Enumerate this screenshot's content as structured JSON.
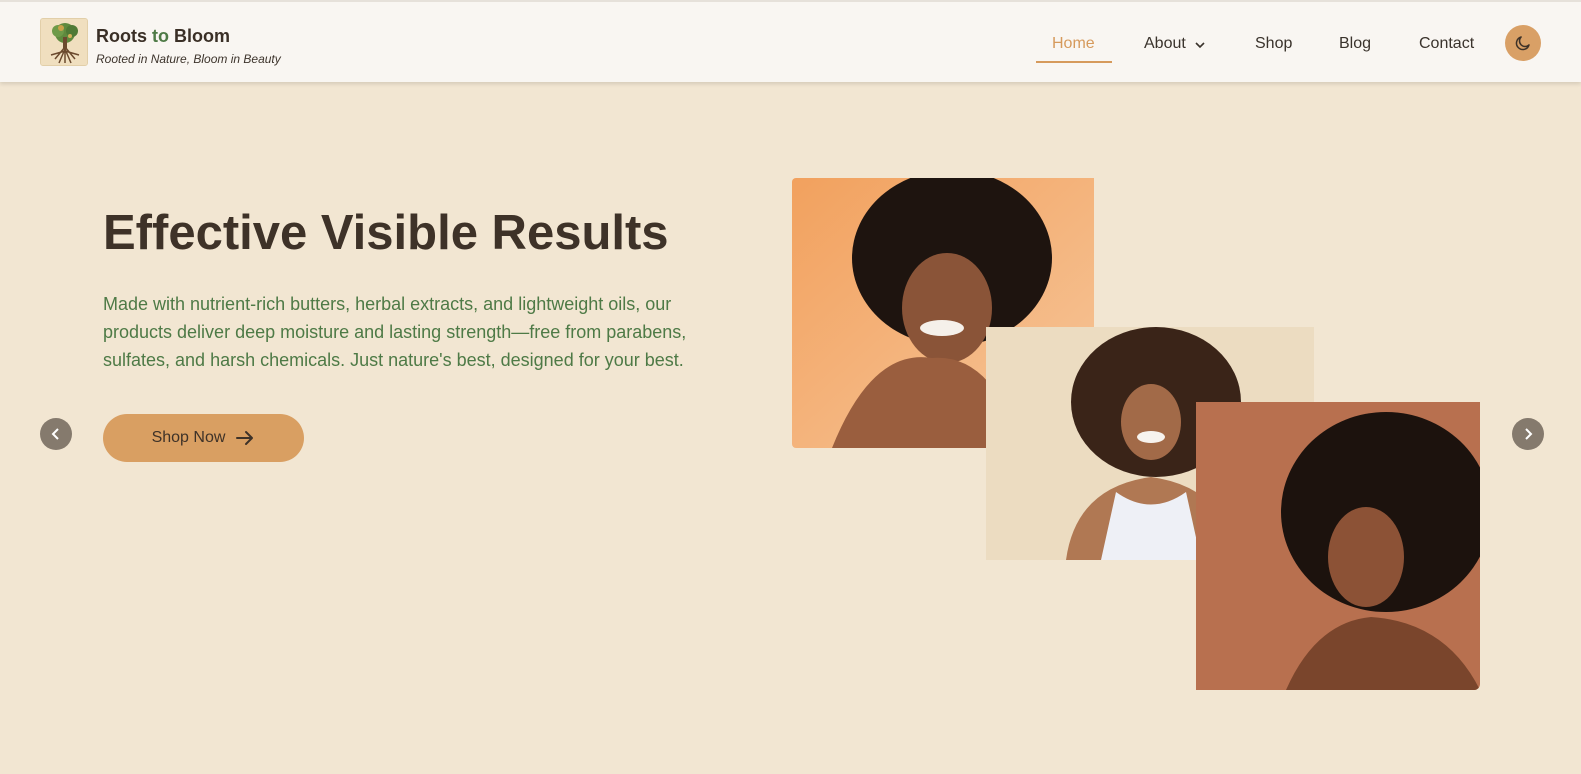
{
  "brand": {
    "name_part1": "Roots ",
    "name_part2": "to",
    "name_part3": " Bloom",
    "tagline": "Rooted in Nature, Bloom in Beauty",
    "logo_icon": "tree-roots-icon"
  },
  "nav": {
    "items": [
      {
        "label": "Home",
        "active": true
      },
      {
        "label": "About",
        "has_dropdown": true
      },
      {
        "label": "Shop"
      },
      {
        "label": "Blog"
      },
      {
        "label": "Contact"
      }
    ],
    "theme_toggle_icon": "moon-icon"
  },
  "hero": {
    "title": "Effective Visible Results",
    "description": "Made with nutrient-rich butters, herbal extracts, and lightweight oils, our products deliver deep moisture and lasting strength—free from parabens, sulfates, and harsh chemicals. Just nature's best, designed for your best.",
    "cta_label": "Shop Now",
    "cta_icon": "arrow-right-icon",
    "prev_icon": "chevron-left-icon",
    "next_icon": "chevron-right-icon"
  },
  "colors": {
    "accent": "#d99f62",
    "green": "#4e7a46",
    "background": "#f2e6d2",
    "header_bg": "#f9f6f2",
    "text_dark": "#3e3228"
  }
}
